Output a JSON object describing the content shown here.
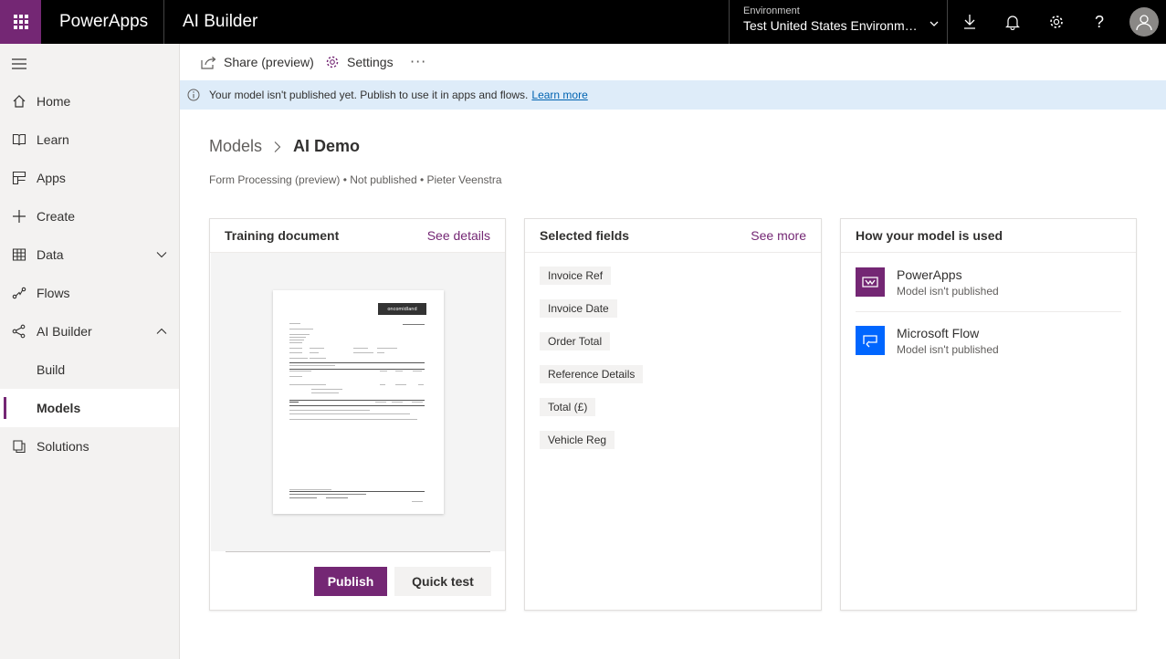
{
  "topbar": {
    "app_name": "PowerApps",
    "section": "AI Builder",
    "environment_label": "Environment",
    "environment_value": "Test United States Environme...",
    "icons": [
      "waffle-icon",
      "download-icon",
      "bell-icon",
      "gear-icon",
      "help-icon",
      "avatar-icon"
    ],
    "accent_color": "#742774"
  },
  "sidebar": {
    "items": [
      {
        "label": "Home",
        "icon": "home-icon"
      },
      {
        "label": "Learn",
        "icon": "book-icon"
      },
      {
        "label": "Apps",
        "icon": "apps-icon"
      },
      {
        "label": "Create",
        "icon": "plus-icon"
      },
      {
        "label": "Data",
        "icon": "table-icon"
      },
      {
        "label": "Flows",
        "icon": "flow-icon"
      },
      {
        "label": "AI Builder",
        "icon": "ai-builder-icon"
      },
      {
        "label": "Build"
      },
      {
        "label": "Models"
      },
      {
        "label": "Solutions",
        "icon": "solutions-icon"
      }
    ],
    "active": "Models"
  },
  "commandbar": {
    "share_label": "Share (preview)",
    "settings_label": "Settings",
    "more_label": "···"
  },
  "infobar": {
    "message": "Your model isn't published yet. Publish to use it in apps and flows.",
    "link": "Learn more"
  },
  "breadcrumb": {
    "parent": "Models",
    "current": "AI Demo"
  },
  "subline": "Form Processing (preview) • Not published • Pieter Veenstra",
  "cards": {
    "training": {
      "title": "Training document",
      "link": "See details",
      "doc_logo": "oncomidland",
      "publish_label": "Publish",
      "quicktest_label": "Quick test"
    },
    "fields": {
      "title": "Selected fields",
      "link": "See more",
      "items": [
        "Invoice Ref",
        "Invoice Date",
        "Order Total",
        "Reference Details",
        "Total (£)",
        "Vehicle Reg"
      ]
    },
    "usage": {
      "title": "How your model is used",
      "items": [
        {
          "name": "PowerApps",
          "status": "Model isn't published",
          "icon": "powerapps-icon",
          "color": "#742774"
        },
        {
          "name": "Microsoft Flow",
          "status": "Model isn't published",
          "icon": "flow-logo-icon",
          "color": "#0066ff"
        }
      ]
    }
  }
}
